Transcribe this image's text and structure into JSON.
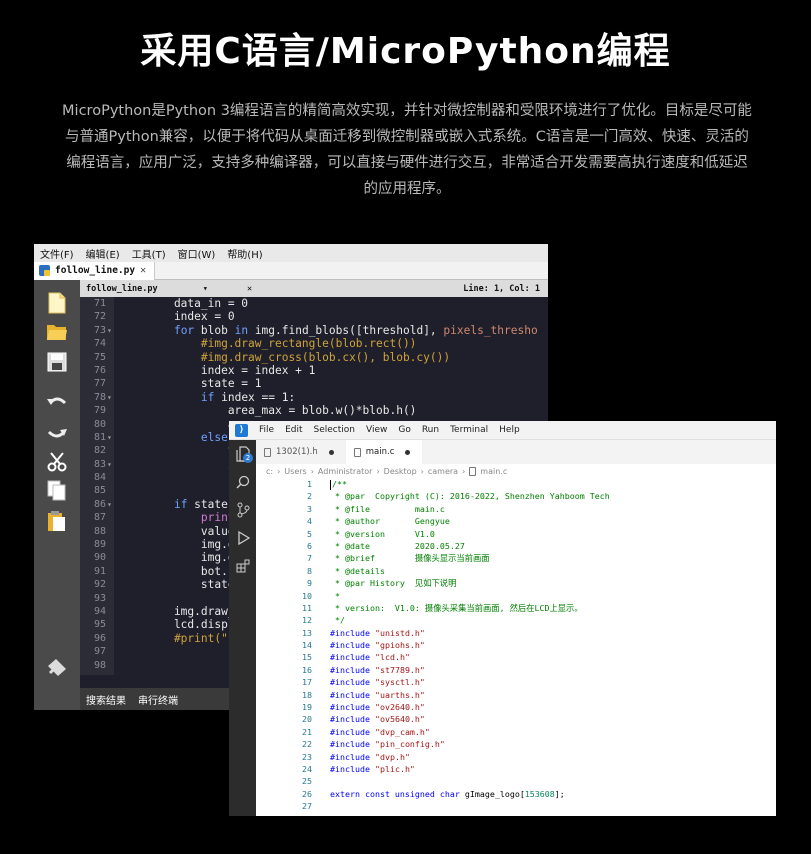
{
  "headline": "采用C语言/MicroPython编程",
  "intro": "MicroPython是Python 3编程语言的精简高效实现，并针对微控制器和受限环境进行了优化。目标是尽可能与普通Python兼容，以便于将代码从桌面迁移到微控制器或嵌入式系统。C语言是一门高效、快速、灵活的编程语言，应用广泛，支持多种编译器，可以直接与硬件进行交互，非常适合开发需要高执行速度和低延迟的应用程序。",
  "ide1": {
    "menu": [
      "文件(F)",
      "编辑(E)",
      "工具(T)",
      "窗口(W)",
      "帮助(H)"
    ],
    "file_tab": "follow_line.py",
    "file_tab_close": "✕",
    "info_file": "follow_line.py",
    "info_arrow": "▾",
    "info_close": "✕",
    "status": "Line: 1, Col: 1",
    "bottom_tabs": [
      "搜索结果",
      "串行终端"
    ],
    "lines": [
      {
        "n": "71",
        "f": "",
        "code": [
          [
            "",
            "    data_in = 0"
          ]
        ]
      },
      {
        "n": "72",
        "f": "",
        "code": [
          [
            "",
            "    index = 0"
          ]
        ]
      },
      {
        "n": "73",
        "f": "▾",
        "code": [
          [
            "",
            "    "
          ],
          [
            "kw",
            "for"
          ],
          [
            "",
            " blob "
          ],
          [
            "kw",
            "in"
          ],
          [
            "",
            " img.find_blobs([threshold], "
          ],
          [
            "py-str",
            "pixels_thresho"
          ]
        ]
      },
      {
        "n": "74",
        "f": "",
        "code": [
          [
            "cm",
            "        #img.draw_rectangle(blob.rect())"
          ]
        ]
      },
      {
        "n": "75",
        "f": "",
        "code": [
          [
            "cm",
            "        #img.draw_cross(blob.cx(), blob.cy())"
          ]
        ]
      },
      {
        "n": "76",
        "f": "",
        "code": [
          [
            "",
            "        index = index + 1"
          ]
        ]
      },
      {
        "n": "77",
        "f": "",
        "code": [
          [
            "",
            "        state = 1"
          ]
        ]
      },
      {
        "n": "78",
        "f": "▾",
        "code": [
          [
            "",
            "        "
          ],
          [
            "kw",
            "if"
          ],
          [
            "",
            " index == 1:"
          ]
        ]
      },
      {
        "n": "79",
        "f": "",
        "code": [
          [
            "",
            "            area_max = blob.w()*blob.h()"
          ]
        ]
      },
      {
        "n": "80",
        "f": "",
        "code": [
          [
            "",
            "            are"
          ]
        ]
      },
      {
        "n": "81",
        "f": "▾",
        "code": [
          [
            "",
            "        "
          ],
          [
            "kw",
            "else:"
          ]
        ]
      },
      {
        "n": "82",
        "f": "",
        "code": [
          [
            "",
            "            tem"
          ]
        ]
      },
      {
        "n": "83",
        "f": "▾",
        "code": [
          [
            "",
            "            "
          ],
          [
            "kw",
            "if"
          ]
        ]
      },
      {
        "n": "84",
        "f": "",
        "code": [
          [
            "",
            ""
          ]
        ]
      },
      {
        "n": "85",
        "f": "",
        "code": [
          [
            "",
            ""
          ]
        ]
      },
      {
        "n": "86",
        "f": "▾",
        "code": [
          [
            "",
            "    "
          ],
          [
            "kw",
            "if"
          ],
          [
            "",
            " state =="
          ]
        ]
      },
      {
        "n": "87",
        "f": "",
        "code": [
          [
            "",
            "        "
          ],
          [
            "pu",
            "print"
          ],
          [
            "",
            "(\""
          ]
        ]
      },
      {
        "n": "88",
        "f": "",
        "code": [
          [
            "",
            "        value ="
          ]
        ]
      },
      {
        "n": "89",
        "f": "",
        "code": [
          [
            "",
            "        img.draw"
          ]
        ]
      },
      {
        "n": "90",
        "f": "",
        "code": [
          [
            "",
            "        img.dra"
          ]
        ]
      },
      {
        "n": "91",
        "f": "",
        "code": [
          [
            "",
            "        bot.set"
          ]
        ]
      },
      {
        "n": "92",
        "f": "",
        "code": [
          [
            "",
            "        state ="
          ]
        ]
      },
      {
        "n": "93",
        "f": "",
        "code": [
          [
            "",
            ""
          ]
        ]
      },
      {
        "n": "94",
        "f": "",
        "code": [
          [
            "",
            "    img.draw_st"
          ]
        ]
      },
      {
        "n": "95",
        "f": "",
        "code": [
          [
            "",
            "    lcd.display"
          ]
        ]
      },
      {
        "n": "96",
        "f": "",
        "code": [
          [
            "cm",
            "    #print(\"FPS"
          ]
        ]
      },
      {
        "n": "97",
        "f": "",
        "code": [
          [
            "",
            ""
          ]
        ]
      },
      {
        "n": "98",
        "f": "",
        "code": [
          [
            "",
            ""
          ]
        ]
      }
    ]
  },
  "ide2": {
    "menu": [
      "File",
      "Edit",
      "Selection",
      "View",
      "Go",
      "Run",
      "Terminal",
      "Help"
    ],
    "badge": "2",
    "tabs": [
      {
        "label": "1302(1).h",
        "active": false
      },
      {
        "label": "main.c",
        "active": true
      }
    ],
    "breadcrumb": [
      "c:",
      "Users",
      "Administrator",
      "Desktop",
      "camera",
      "main.c"
    ],
    "lines": [
      {
        "n": "1",
        "code": [
          [
            "cur",
            ""
          ],
          [
            "cm",
            "/**"
          ]
        ]
      },
      {
        "n": "2",
        "code": [
          [
            "cm",
            " * @par  Copyright (C): 2016-2022, Shenzhen Yahboom Tech"
          ]
        ]
      },
      {
        "n": "3",
        "code": [
          [
            "cm",
            " * @file         main.c"
          ]
        ]
      },
      {
        "n": "4",
        "code": [
          [
            "cm",
            " * @author       Gengyue"
          ]
        ]
      },
      {
        "n": "5",
        "code": [
          [
            "cm",
            " * @version      V1.0"
          ]
        ]
      },
      {
        "n": "6",
        "code": [
          [
            "cm",
            " * @date         2020.05.27"
          ]
        ]
      },
      {
        "n": "7",
        "code": [
          [
            "cm",
            " * @brief        摄像头显示当前画面"
          ]
        ]
      },
      {
        "n": "8",
        "code": [
          [
            "cm",
            " * @details"
          ]
        ]
      },
      {
        "n": "9",
        "code": [
          [
            "cm",
            " * @par History  见如下说明"
          ]
        ]
      },
      {
        "n": "10",
        "code": [
          [
            "cm",
            " *"
          ]
        ]
      },
      {
        "n": "11",
        "code": [
          [
            "cm",
            " * version:  V1.0: 摄像头采集当前画面, 然后在LCD上显示。"
          ]
        ]
      },
      {
        "n": "12",
        "code": [
          [
            "cm",
            " */"
          ]
        ]
      },
      {
        "n": "13",
        "code": [
          [
            "kw2",
            "#include"
          ],
          [
            "tx2",
            " "
          ],
          [
            "st2",
            "\"unistd.h\""
          ]
        ]
      },
      {
        "n": "14",
        "code": [
          [
            "kw2",
            "#include"
          ],
          [
            "tx2",
            " "
          ],
          [
            "st2",
            "\"gpiohs.h\""
          ]
        ]
      },
      {
        "n": "15",
        "code": [
          [
            "kw2",
            "#include"
          ],
          [
            "tx2",
            " "
          ],
          [
            "st2",
            "\"lcd.h\""
          ]
        ]
      },
      {
        "n": "16",
        "code": [
          [
            "kw2",
            "#include"
          ],
          [
            "tx2",
            " "
          ],
          [
            "st2",
            "\"st7789.h\""
          ]
        ]
      },
      {
        "n": "17",
        "code": [
          [
            "kw2",
            "#include"
          ],
          [
            "tx2",
            " "
          ],
          [
            "st2",
            "\"sysctl.h\""
          ]
        ]
      },
      {
        "n": "18",
        "code": [
          [
            "kw2",
            "#include"
          ],
          [
            "tx2",
            " "
          ],
          [
            "st2",
            "\"uarths.h\""
          ]
        ]
      },
      {
        "n": "19",
        "code": [
          [
            "kw2",
            "#include"
          ],
          [
            "tx2",
            " "
          ],
          [
            "st2",
            "\"ov2640.h\""
          ]
        ]
      },
      {
        "n": "20",
        "code": [
          [
            "kw2",
            "#include"
          ],
          [
            "tx2",
            " "
          ],
          [
            "st2",
            "\"ov5640.h\""
          ]
        ]
      },
      {
        "n": "21",
        "code": [
          [
            "kw2",
            "#include"
          ],
          [
            "tx2",
            " "
          ],
          [
            "st2",
            "\"dvp_cam.h\""
          ]
        ]
      },
      {
        "n": "22",
        "code": [
          [
            "kw2",
            "#include"
          ],
          [
            "tx2",
            " "
          ],
          [
            "st2",
            "\"pin_config.h\""
          ]
        ]
      },
      {
        "n": "23",
        "code": [
          [
            "kw2",
            "#include"
          ],
          [
            "tx2",
            " "
          ],
          [
            "st2",
            "\"dvp.h\""
          ]
        ]
      },
      {
        "n": "24",
        "code": [
          [
            "kw2",
            "#include"
          ],
          [
            "tx2",
            " "
          ],
          [
            "st2",
            "\"plic.h\""
          ]
        ]
      },
      {
        "n": "25",
        "code": [
          [
            "tx2",
            ""
          ]
        ]
      },
      {
        "n": "26",
        "code": [
          [
            "kw2",
            "extern const unsigned char"
          ],
          [
            "tx2",
            " gImage_logo["
          ],
          [
            "nm2",
            "153608"
          ],
          [
            "tx2",
            "];"
          ]
        ]
      },
      {
        "n": "27",
        "code": [
          [
            "tx2",
            ""
          ]
        ]
      }
    ]
  }
}
